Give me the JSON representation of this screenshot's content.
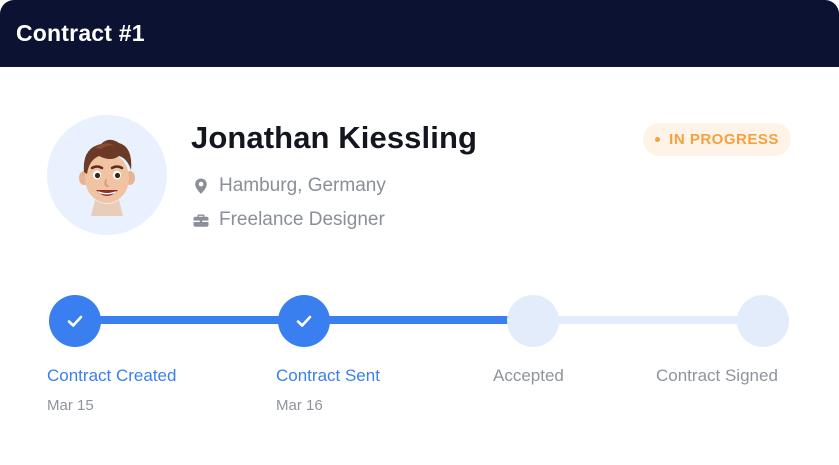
{
  "header": {
    "title": "Contract #1",
    "background": "#0c1232"
  },
  "profile": {
    "name": "Jonathan Kiessling",
    "location": "Hamburg, Germany",
    "role": "Freelance Designer",
    "avatar_icon": "memoji-avatar",
    "location_icon": "map-pin-icon",
    "role_icon": "briefcase-icon"
  },
  "status": {
    "label": "IN PROGRESS",
    "color": "#f4a13f",
    "background": "#fff3e7"
  },
  "steps": [
    {
      "label": "Contract Created",
      "date": "Mar 15",
      "state": "done"
    },
    {
      "label": "Contract Sent",
      "date": "Mar 16",
      "state": "done"
    },
    {
      "label": "Accepted",
      "date": "",
      "state": "todo"
    },
    {
      "label": "Contract Signed",
      "date": "",
      "state": "todo"
    }
  ],
  "colors": {
    "accent": "#3a7ff0",
    "inactive": "#e2ecfb",
    "muted_text": "#8f949c"
  }
}
